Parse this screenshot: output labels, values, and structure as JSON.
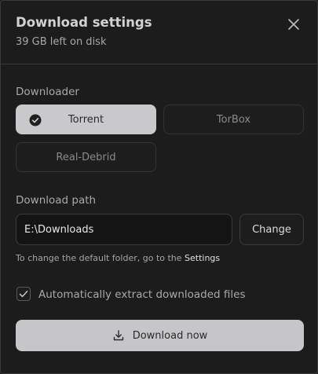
{
  "header": {
    "title": "Download settings",
    "subtitle": "39 GB left on disk",
    "close_icon": "close-icon"
  },
  "downloader": {
    "label": "Downloader",
    "options": [
      {
        "label": "Torrent",
        "selected": true
      },
      {
        "label": "TorBox",
        "selected": false
      },
      {
        "label": "Real-Debrid",
        "selected": false
      }
    ]
  },
  "path": {
    "label": "Download path",
    "value": "E:\\Downloads",
    "change_label": "Change",
    "hint_text": "To change the default folder, go to the ",
    "hint_link": "Settings"
  },
  "extract": {
    "label": "Automatically extract downloaded files",
    "checked": true
  },
  "action": {
    "label": "Download now",
    "icon": "download-icon"
  },
  "colors": {
    "background": "#1c1c1c",
    "selected": "#c9c9cc",
    "primary_button": "#c6c6c9"
  }
}
